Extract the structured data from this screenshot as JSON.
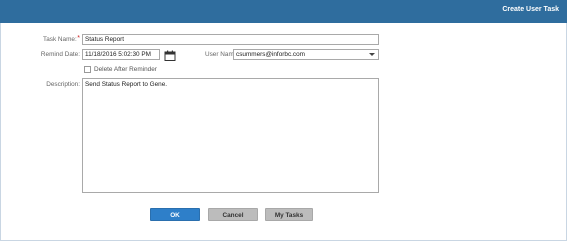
{
  "window": {
    "title": "Create User Task"
  },
  "form": {
    "task_name_label": "Task Name:",
    "required_marker": "*",
    "task_name_value": "Status Report",
    "remind_date_label": "Remind Date:",
    "remind_date_value": "11/18/2016 5:02:30 PM",
    "user_name_label": "User Name:",
    "user_name_value": "csummers@inforbc.com",
    "delete_after_reminder_label": "Delete After Reminder",
    "delete_after_reminder_checked": false,
    "description_label": "Description:",
    "description_value": "Send Status Report to Gene."
  },
  "buttons": {
    "ok_label": "OK",
    "cancel_label": "Cancel",
    "my_tasks_label": "My Tasks"
  },
  "colors": {
    "titlebar": "#2f6d9e",
    "primary_button": "#2e7fc9",
    "secondary_button": "#bcbcbc"
  },
  "icons": {
    "calendar": "calendar-icon",
    "dropdown": "chevron-down-icon"
  }
}
